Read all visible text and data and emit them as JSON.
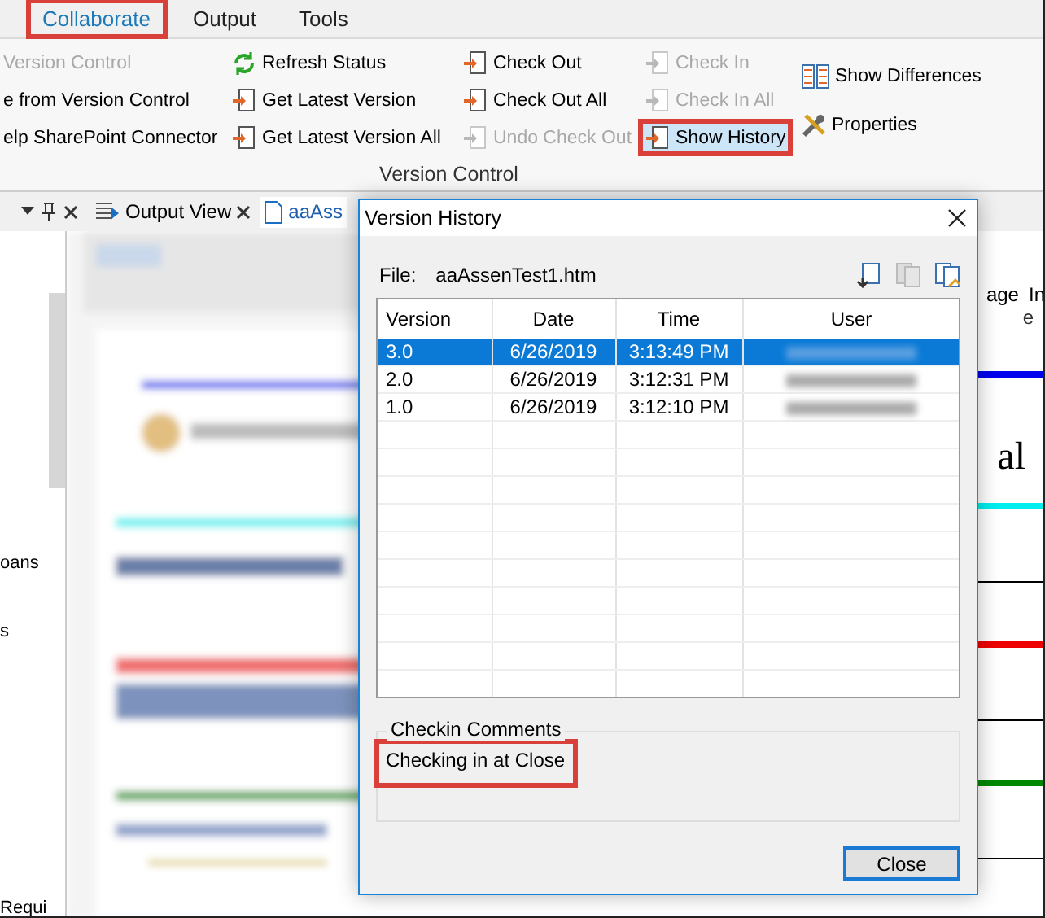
{
  "ribbon": {
    "tabs": [
      {
        "label": "Collaborate",
        "selected": true,
        "annotated": true
      },
      {
        "label": "Output",
        "selected": false,
        "annotated": false
      },
      {
        "label": "Tools",
        "selected": false,
        "annotated": false
      }
    ],
    "columns": [
      [
        {
          "label": "Version Control",
          "disabled": true,
          "annotated": false
        },
        {
          "label": "e from Version Control",
          "disabled": false,
          "annotated": false
        },
        {
          "label": "elp SharePoint Connector",
          "disabled": false,
          "annotated": false
        }
      ],
      [
        {
          "label": "Refresh Status",
          "disabled": false,
          "annotated": false
        },
        {
          "label": "Get Latest Version",
          "disabled": false,
          "annotated": false
        },
        {
          "label": "Get Latest Version All",
          "disabled": false,
          "annotated": false
        }
      ],
      [
        {
          "label": "Check Out",
          "disabled": false,
          "annotated": false
        },
        {
          "label": "Check Out All",
          "disabled": false,
          "annotated": false
        },
        {
          "label": "Undo Check Out",
          "disabled": true,
          "annotated": false
        }
      ],
      [
        {
          "label": "Check In",
          "disabled": true,
          "annotated": false
        },
        {
          "label": "Check In All",
          "disabled": true,
          "annotated": false
        },
        {
          "label": "Show History",
          "disabled": false,
          "annotated": true
        }
      ],
      [
        {
          "label": "Show Differences",
          "disabled": false,
          "annotated": false
        },
        {
          "label": "Properties",
          "disabled": false,
          "annotated": false
        }
      ]
    ],
    "group_label": "Version Control"
  },
  "doc_tabs": [
    {
      "label": "Output View",
      "selected": false
    },
    {
      "label": "aaAss",
      "selected": true
    }
  ],
  "side_panel": {
    "texts": [
      "oans",
      "s",
      "Requi"
    ]
  },
  "document": {
    "ruler_texts": [
      "age",
      "In"
    ],
    "ruler_mark": "e",
    "heading_fragment": "al"
  },
  "dialog": {
    "title": "Version History",
    "file_label": "File:",
    "file_name": "aaAssenTest1.htm",
    "columns": [
      "Version",
      "Date",
      "Time",
      "User"
    ],
    "rows": [
      {
        "version": "3.0",
        "date": "6/26/2019",
        "time": "3:13:49 PM",
        "selected": true
      },
      {
        "version": "2.0",
        "date": "6/26/2019",
        "time": "3:12:31 PM",
        "selected": false
      },
      {
        "version": "1.0",
        "date": "6/26/2019",
        "time": "3:12:10 PM",
        "selected": false
      }
    ],
    "comments_label": "Checkin Comments",
    "comment": "Checking in at Close",
    "comment_annotated": true,
    "close_button": "Close"
  }
}
